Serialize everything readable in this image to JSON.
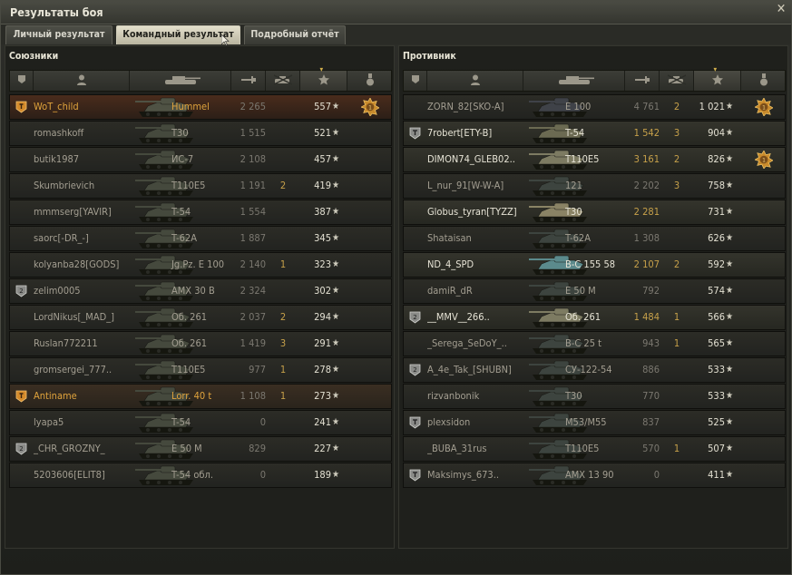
{
  "window": {
    "title": "Результаты боя",
    "close": "✕"
  },
  "tabs": [
    {
      "label": "Личный результат",
      "active": false
    },
    {
      "label": "Командный результат",
      "active": true
    },
    {
      "label": "Подробный отчёт",
      "active": false
    }
  ],
  "allies": {
    "title": "Союзники",
    "rows": [
      {
        "name": "WoT_child",
        "tank": "Hummel",
        "damage": "2 265",
        "kills": "",
        "xp": "557",
        "badge": "platoon",
        "style": "gold",
        "medal": true,
        "tank_color": "#4f5244"
      },
      {
        "name": "romashkoff",
        "tank": "T30",
        "damage": "1 515",
        "kills": "",
        "xp": "521",
        "badge": "",
        "style": "dead",
        "medal": false,
        "tank_color": "#45493d"
      },
      {
        "name": "butik1987",
        "tank": "ИС-7",
        "damage": "2 108",
        "kills": "",
        "xp": "457",
        "badge": "",
        "style": "dead",
        "medal": false,
        "tank_color": "#45493d"
      },
      {
        "name": "Skumbrievich",
        "tank": "T110E5",
        "damage": "1 191",
        "kills": "2",
        "xp": "419",
        "badge": "",
        "style": "dead",
        "medal": false,
        "tank_color": "#45493d"
      },
      {
        "name": "mmmserg[YAVIR]",
        "tank": "T-54",
        "damage": "1 554",
        "kills": "",
        "xp": "387",
        "badge": "",
        "style": "dead",
        "medal": false,
        "tank_color": "#45493d"
      },
      {
        "name": "saorc[-DR_-]",
        "tank": "T-62A",
        "damage": "1 887",
        "kills": "",
        "xp": "345",
        "badge": "",
        "style": "dead",
        "medal": false,
        "tank_color": "#45493d"
      },
      {
        "name": "kolyanba28[GODS]",
        "tank": "Jg.Pz. E 100",
        "damage": "2 140",
        "kills": "1",
        "xp": "323",
        "badge": "",
        "style": "dead",
        "medal": false,
        "tank_color": "#45493d"
      },
      {
        "name": "zelim0005",
        "tank": "AMX 30 B",
        "damage": "2 324",
        "kills": "",
        "xp": "302",
        "badge": "platoon2",
        "style": "dead",
        "medal": false,
        "tank_color": "#45493d"
      },
      {
        "name": "LordNikus[_MAD_]",
        "tank": "Об. 261",
        "damage": "2 037",
        "kills": "2",
        "xp": "294",
        "badge": "",
        "style": "dead",
        "medal": false,
        "tank_color": "#45493d"
      },
      {
        "name": "Ruslan772211",
        "tank": "Об. 261",
        "damage": "1 419",
        "kills": "3",
        "xp": "291",
        "badge": "",
        "style": "dead",
        "medal": false,
        "tank_color": "#45493d"
      },
      {
        "name": "gromsergei_777..",
        "tank": "T110E5",
        "damage": "977",
        "kills": "1",
        "xp": "278",
        "badge": "",
        "style": "dead",
        "medal": false,
        "tank_color": "#45493d"
      },
      {
        "name": "Antiname",
        "tank": "Lorr. 40 t",
        "damage": "1 108",
        "kills": "1",
        "xp": "273",
        "badge": "platoon",
        "style": "gold",
        "medal": false,
        "tank_color": "#45493d"
      },
      {
        "name": "lyapa5",
        "tank": "T-54",
        "damage": "0",
        "kills": "",
        "xp": "241",
        "badge": "",
        "style": "dead",
        "medal": false,
        "tank_color": "#45493d"
      },
      {
        "name": "_CHR_GROZNY_",
        "tank": "E 50 M",
        "damage": "829",
        "kills": "",
        "xp": "227",
        "badge": "platoon2",
        "style": "dead",
        "medal": false,
        "tank_color": "#45493d"
      },
      {
        "name": "5203606[ELIT8]",
        "tank": "T-54 обл.",
        "damage": "0",
        "kills": "",
        "xp": "189",
        "badge": "",
        "style": "dead",
        "medal": false,
        "tank_color": "#45493d"
      }
    ]
  },
  "enemies": {
    "title": "Противник",
    "rows": [
      {
        "name": "ZORN_82[SKO-A]",
        "tank": "E 100",
        "damage": "4 761",
        "kills": "2",
        "xp": "1 021",
        "badge": "",
        "style": "dead",
        "medal": true,
        "tank_color": "#3f4248"
      },
      {
        "name": "7robert[ETY-B]",
        "tank": "T-54",
        "damage": "1 542",
        "kills": "3",
        "xp": "904",
        "badge": "platoon3",
        "style": "alive",
        "medal": false,
        "tank_color": "#6b6a52"
      },
      {
        "name": "DIMON74_GLEB02..",
        "tank": "T110E5",
        "damage": "3 161",
        "kills": "2",
        "xp": "826",
        "badge": "",
        "style": "alive",
        "medal": true,
        "tank_color": "#7d7b62"
      },
      {
        "name": "L_nur_91[W-W-A]",
        "tank": "121",
        "damage": "2 202",
        "kills": "3",
        "xp": "758",
        "badge": "",
        "style": "dead",
        "medal": false,
        "tank_color": "#3d443f"
      },
      {
        "name": "Globus_tyran[TYZZ]",
        "tank": "T30",
        "damage": "2 281",
        "kills": "",
        "xp": "731",
        "badge": "",
        "style": "alive",
        "medal": false,
        "tank_color": "#8a8365"
      },
      {
        "name": "Shataisan",
        "tank": "T-62A",
        "damage": "1 308",
        "kills": "",
        "xp": "626",
        "badge": "",
        "style": "dead",
        "medal": false,
        "tank_color": "#3d443f"
      },
      {
        "name": "ND_4_SPD",
        "tank": "B-C 155 58",
        "damage": "2 107",
        "kills": "2",
        "xp": "592",
        "badge": "",
        "style": "alive",
        "medal": false,
        "tank_color": "#5b8a8c"
      },
      {
        "name": "damiR_dR",
        "tank": "E 50 M",
        "damage": "792",
        "kills": "",
        "xp": "574",
        "badge": "",
        "style": "dead",
        "medal": false,
        "tank_color": "#3d443f"
      },
      {
        "name": "__MMV__266..",
        "tank": "Об. 261",
        "damage": "1 484",
        "kills": "1",
        "xp": "566",
        "badge": "platoon2",
        "style": "alive",
        "medal": false,
        "tank_color": "#7d7b62"
      },
      {
        "name": "_Serega_SeDoY_..",
        "tank": "B-C 25 t",
        "damage": "943",
        "kills": "1",
        "xp": "565",
        "badge": "",
        "style": "dead",
        "medal": false,
        "tank_color": "#3d443f"
      },
      {
        "name": "A_4e_Tak_[SHUBN]",
        "tank": "СУ-122-54",
        "damage": "886",
        "kills": "",
        "xp": "533",
        "badge": "platoon2",
        "style": "dead",
        "medal": false,
        "tank_color": "#3d443f"
      },
      {
        "name": "rizvanbonik",
        "tank": "T30",
        "damage": "770",
        "kills": "",
        "xp": "533",
        "badge": "",
        "style": "dead",
        "medal": false,
        "tank_color": "#3d443f"
      },
      {
        "name": "plexsidon",
        "tank": "M53/M55",
        "damage": "837",
        "kills": "",
        "xp": "525",
        "badge": "platoon3",
        "style": "dead",
        "medal": false,
        "tank_color": "#3d443f"
      },
      {
        "name": "_BUBA_31rus",
        "tank": "T110E5",
        "damage": "570",
        "kills": "1",
        "xp": "507",
        "badge": "",
        "style": "dead",
        "medal": false,
        "tank_color": "#3d443f"
      },
      {
        "name": "Maksimys_673..",
        "tank": "AMX 13 90",
        "damage": "0",
        "kills": "",
        "xp": "411",
        "badge": "platoon3",
        "style": "dead",
        "medal": false,
        "tank_color": "#3d443f"
      }
    ]
  }
}
